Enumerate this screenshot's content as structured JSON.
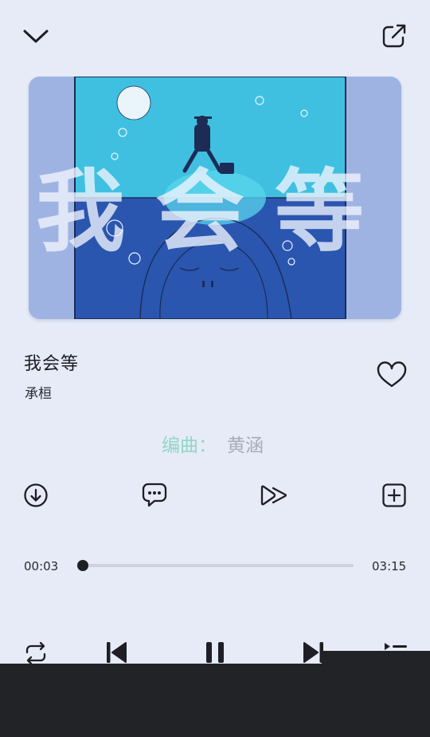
{
  "header": {
    "collapse_icon": "chevron-down-icon",
    "share_icon": "share-external-icon"
  },
  "album_art": {
    "title_art_text": "我会等",
    "colors": {
      "sky": "#40c0e0",
      "sea": "#2a56b0",
      "frame": "#9fb3e3"
    }
  },
  "track": {
    "title": "我会等",
    "artist": "承桓",
    "favorite_icon": "heart-outline-icon"
  },
  "lyric_line": {
    "label": "编曲：",
    "name": "黄涵"
  },
  "actions": [
    {
      "name": "download",
      "icon": "download-icon"
    },
    {
      "name": "comments",
      "icon": "comment-icon"
    },
    {
      "name": "speed",
      "icon": "fast-forward-icon"
    },
    {
      "name": "add-to-playlist",
      "icon": "add-box-icon"
    }
  ],
  "progress": {
    "current": "00:03",
    "total": "03:15",
    "fraction": 0.015
  },
  "controls": [
    {
      "name": "repeat",
      "icon": "repeat-icon"
    },
    {
      "name": "previous",
      "icon": "skip-previous-icon"
    },
    {
      "name": "pause",
      "icon": "pause-icon"
    },
    {
      "name": "next",
      "icon": "skip-next-icon"
    },
    {
      "name": "playlist",
      "icon": "queue-list-icon"
    }
  ],
  "colors": {
    "background": "#e6ebf7",
    "text": "#1c1c22",
    "lyric_label": "#8fd7c8",
    "lyric_name": "#a8acb6",
    "track": "#cdd2dd",
    "bottom_bar": "#222327"
  }
}
